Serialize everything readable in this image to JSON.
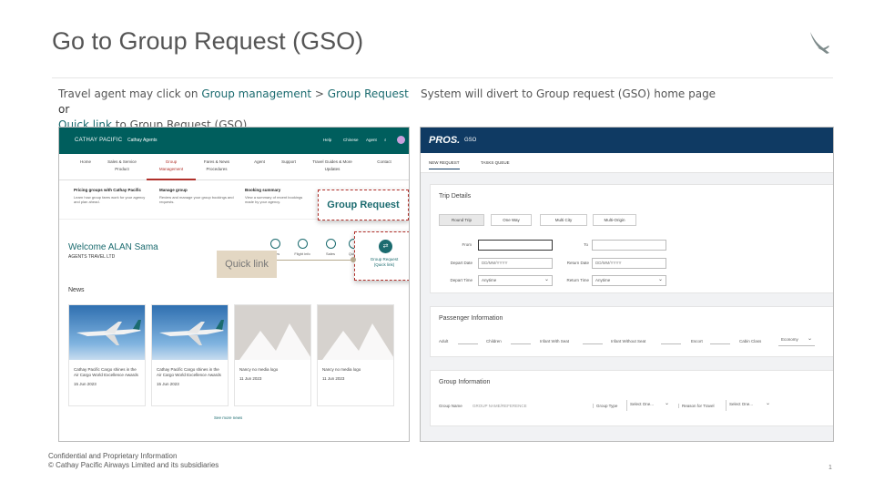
{
  "slide": {
    "title": "Go to Group Request (GSO)",
    "page_number": "1",
    "footer_line1": "Confidential and Proprietary Information",
    "footer_line2": "© Cathay Pacific Airways Limited and its subsidiaries"
  },
  "intro": {
    "prefix": "Travel agent may click on ",
    "link1": "Group management",
    "sep": " > ",
    "link2": "Group Request",
    "or": "  or",
    "link3": "Quick link",
    "suffix": " to Group Request (GSO)"
  },
  "system_note": "System will divert to Group request (GSO) home page",
  "left_shot": {
    "brand": "CATHAY PACIFIC",
    "portal": "Cathay Agents",
    "util": [
      "Help",
      "Chinese",
      "Agent"
    ],
    "nav": [
      {
        "label": "Home",
        "sub": ""
      },
      {
        "label": "Sales & Service",
        "sub": "Product"
      },
      {
        "label": "Group",
        "sub": "Management"
      },
      {
        "label": "Fares & News",
        "sub": "Procedures"
      },
      {
        "label": "Agent",
        "sub": ""
      },
      {
        "label": "Support",
        "sub": ""
      },
      {
        "label": "Travel Guides & More",
        "sub": "Updates"
      },
      {
        "label": "Contact",
        "sub": ""
      }
    ],
    "cards": [
      {
        "title": "Pricing groups with Cathay Pacific",
        "desc": "Learn how group fares work for your agency and plan ahead."
      },
      {
        "title": "Manage group",
        "desc": "Review and manage your group bookings and requests."
      },
      {
        "title": "Booking summary",
        "desc": "View a summary of recent bookings made by your agency."
      }
    ],
    "group_request_label": "Group Request",
    "welcome": "Welcome ALAN Sama",
    "welcome_sub": "AGENTS TRAVEL LTD",
    "quick_icons": [
      "Fares",
      "Flight info",
      "Sales",
      "Quick"
    ],
    "quick_link_label": "Group Request\n(Quick link)",
    "quick_link_tag": "Quick link",
    "news_heading": "News",
    "news": [
      {
        "title": "Cathay Pacific Cargo shines in the Air Cargo World Excellence Awards",
        "date": "15 Jun 2023",
        "img": "plane"
      },
      {
        "title": "Cathay Pacific Cargo shines in the Air Cargo World Excellence Awards",
        "date": "15 Jun 2023",
        "img": "plane"
      },
      {
        "title": "Nancy no media logo",
        "date": "11 Jun 2023",
        "img": "placeholder"
      },
      {
        "title": "Nancy no media logo",
        "date": "11 Jun 2023",
        "img": "placeholder"
      }
    ],
    "see_more": "See more news"
  },
  "right_shot": {
    "logo": "PROS.",
    "app": "GSO",
    "tabs": [
      "NEW REQUEST",
      "TASKS QUEUE"
    ],
    "trip": {
      "heading": "Trip Details",
      "segments": [
        "Round Trip",
        "One Way",
        "Multi City",
        "Multi-Origin"
      ],
      "from_label": "From",
      "to_label": "To",
      "depart_date_label": "Depart Date",
      "depart_date_placeholder": "DD/MM/YYYY",
      "return_date_label": "Return Date",
      "return_date_placeholder": "DD/MM/YYYY",
      "depart_time_label": "Depart Time",
      "depart_time_value": "Anytime",
      "return_time_label": "Return Time",
      "return_time_value": "Anytime"
    },
    "passenger": {
      "heading": "Passenger Information",
      "fields": [
        "Adult",
        "Children",
        "Infant With Seat",
        "Infant Without Seat",
        "Escort"
      ],
      "cabin_label": "Cabin Class",
      "cabin_value": "Economy"
    },
    "group": {
      "heading": "Group Information",
      "name_label": "Group Name",
      "name_placeholder": "GROUP NAME/REFERENCE",
      "type_label": "Group Type",
      "type_value": "Select One...",
      "reason_label": "Reason for Travel",
      "reason_value": "Select One..."
    }
  }
}
